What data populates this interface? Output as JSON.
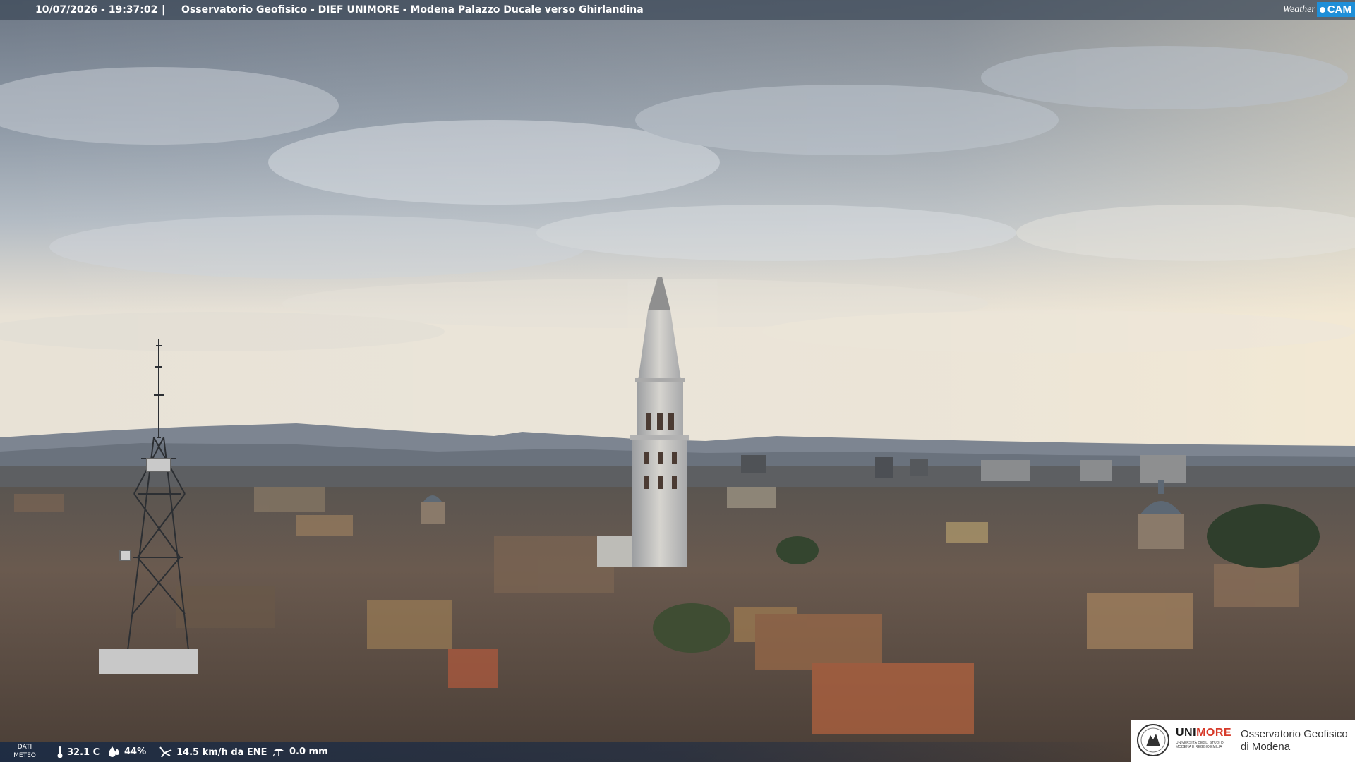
{
  "overlay": {
    "timestamp": "10/07/2026 - 19:37:02",
    "separator": "|",
    "caption": "Osservatorio Geofisico - DIEF UNIMORE - Modena Palazzo Ducale verso Ghirlandina"
  },
  "weathercam_logo": {
    "word": "Weather",
    "badge": "CAM",
    "badge_color": "#1f8fd8"
  },
  "weather": {
    "label_line1": "DATI",
    "label_line2": "METEO",
    "temperature": "32.1 C",
    "temperature_icon": "thermometer-icon",
    "humidity": "44%",
    "humidity_icon": "humidity-drop-icon",
    "wind": "14.5 km/h da ENE",
    "wind_icon": "wind-icon",
    "rain": "0.0 mm",
    "rain_icon": "rain-icon"
  },
  "unimore": {
    "name_plain": "UNI",
    "name_accent": "MORE",
    "accent_color": "#d73a2a",
    "subtitle": "UNIVERSITÀ DEGLI STUDI DI MODENA E REGGIO EMILIA",
    "observatory_line1": "Osservatorio Geofisico",
    "observatory_line2": "di Modena"
  },
  "scene": {
    "subject": "Ghirlandina",
    "sky_color": "#8f9aa6",
    "roof_color": "#6e5a4c"
  }
}
